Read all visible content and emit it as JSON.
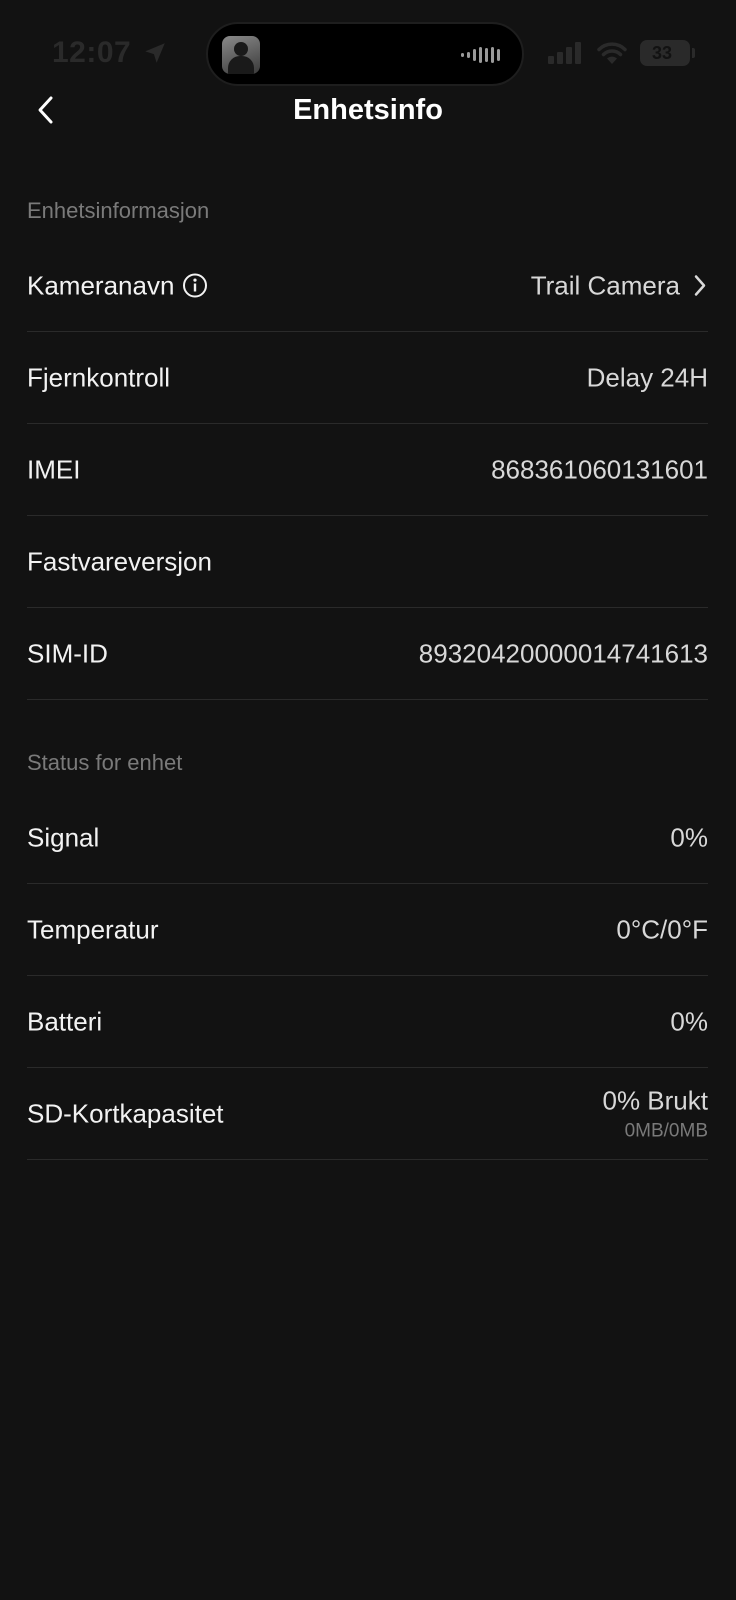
{
  "status_bar": {
    "time": "12:07",
    "battery": "33"
  },
  "header": {
    "title": "Enhetsinfo"
  },
  "device_info": {
    "section_title": "Enhetsinformasjon",
    "rows": [
      {
        "label": "Kameranavn",
        "value": "Trail Camera"
      },
      {
        "label": "Fjernkontroll",
        "value": "Delay 24H"
      },
      {
        "label": "IMEI",
        "value": "868361060131601"
      },
      {
        "label": "Fastvareversjon",
        "value": ""
      },
      {
        "label": "SIM-ID",
        "value": "89320420000014741613"
      }
    ]
  },
  "device_status": {
    "section_title": "Status for enhet",
    "rows": [
      {
        "label": "Signal",
        "value": "0%"
      },
      {
        "label": "Temperatur",
        "value": "0°C/0°F"
      },
      {
        "label": "Batteri",
        "value": "0%"
      },
      {
        "label": "SD-Kortkapasitet",
        "value": "0% Brukt",
        "sub_value": "0MB/0MB"
      }
    ]
  },
  "colors": {
    "background": "#121212",
    "text_primary": "#f2f2f2",
    "text_secondary": "#7a7a7a",
    "divider": "#2a2a2a"
  }
}
